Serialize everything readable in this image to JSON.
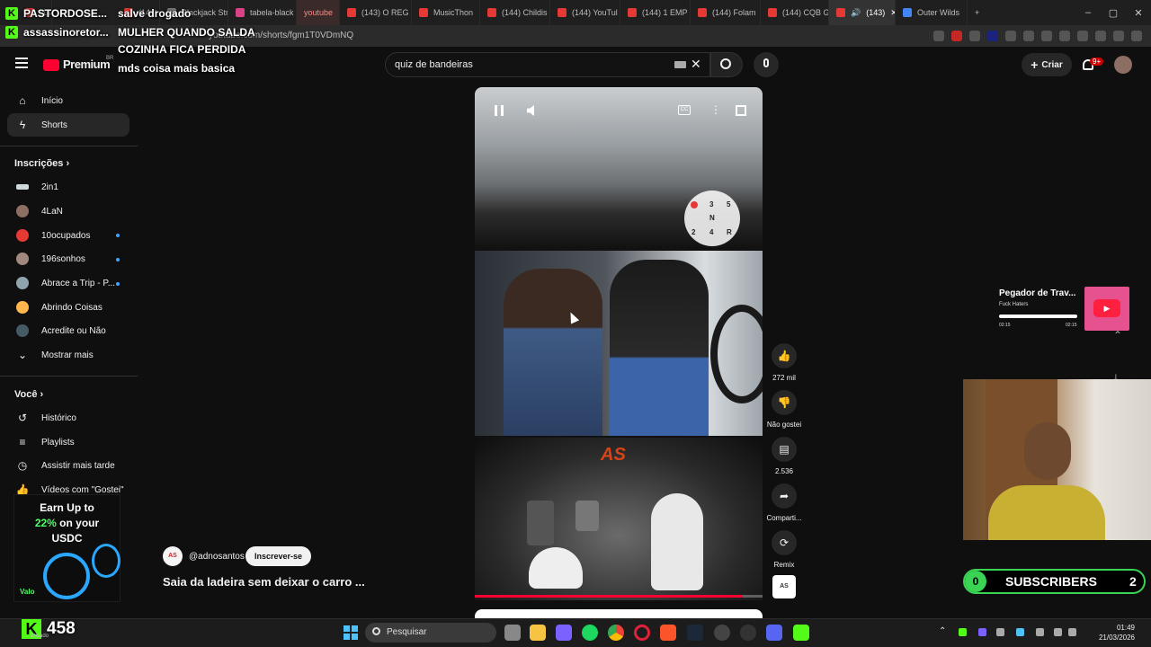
{
  "browser": {
    "tabs": [
      {
        "label": "(144) te...",
        "active": false
      },
      {
        "label": "(144) we",
        "active": false
      },
      {
        "label": "Blackjack Str",
        "active": false
      },
      {
        "label": "tabela-black",
        "active": false
      },
      {
        "label": "youtube",
        "active": false
      },
      {
        "label": "(143) O REG",
        "active": false
      },
      {
        "label": "MusicThon",
        "active": false
      },
      {
        "label": "(144) Childis",
        "active": false
      },
      {
        "label": "(144) YouTul",
        "active": false
      },
      {
        "label": "(144) 1 EMP",
        "active": false
      },
      {
        "label": "(144) Folam",
        "active": false
      },
      {
        "label": "(144) CQB G",
        "active": false
      },
      {
        "label": "(143)",
        "active": true
      },
      {
        "label": "Outer Wilds",
        "active": false
      }
    ],
    "url": "youtube.com/shorts/fgm1T0VDmNQ",
    "new_tab": "+",
    "window_controls": [
      "–",
      "▢",
      "✕"
    ]
  },
  "chat_overlay": {
    "lines": [
      {
        "user": "PASTORDOSE...",
        "message": "salve drogado"
      },
      {
        "user": "assassinoretor...",
        "message": "MULHER QUANDO SALDA"
      },
      {
        "user": "",
        "message": "COZINHA FICA PERDIDA"
      },
      {
        "user": "",
        "message": "mds coisa mais basica"
      }
    ]
  },
  "youtube": {
    "logo_text": "Premium",
    "logo_region": "BR",
    "search_value": "quiz de bandeiras",
    "create_label": "Criar",
    "notifications_badge": "9+",
    "sidebar": {
      "main": [
        {
          "label": "Início",
          "icon": "home-icon",
          "active": false
        },
        {
          "label": "Shorts",
          "icon": "shorts-icon",
          "active": true
        }
      ],
      "subscriptions_title": "Inscrições",
      "subscriptions": [
        {
          "label": "2in1",
          "color": "#cfd8dc",
          "new": false
        },
        {
          "label": "4LaN",
          "color": "#8d6e63",
          "new": false
        },
        {
          "label": "10ocupados",
          "color": "#e53935",
          "new": true
        },
        {
          "label": "196sonhos",
          "color": "#a1887f",
          "new": true
        },
        {
          "label": "Abrace a Trip - P...",
          "color": "#90a4ae",
          "new": true
        },
        {
          "label": "Abrindo Coisas",
          "color": "#ffb74d",
          "new": false
        },
        {
          "label": "Acredite ou Não",
          "color": "#455a64",
          "new": false
        }
      ],
      "show_more": "Mostrar mais",
      "you_title": "Você",
      "you_items": [
        {
          "label": "Histórico",
          "icon": "history-icon"
        },
        {
          "label": "Playlists",
          "icon": "playlists-icon"
        },
        {
          "label": "Assistir mais tarde",
          "icon": "watch-later-icon"
        },
        {
          "label": "Vídeos com \"Gostei\"",
          "icon": "liked-icon"
        }
      ]
    },
    "short": {
      "channel": "@adnosantos",
      "channel_avatar_text": "AS",
      "subscribe_label": "Inscrever-se",
      "title": "Saia da ladeira sem deixar o carro ...",
      "progress": 0.93,
      "gear_labels": [
        "1",
        "3",
        "5",
        "N",
        "2",
        "4",
        "R"
      ],
      "video_watermark": "AS",
      "actions": [
        {
          "icon": "like-icon",
          "label": "272 mil"
        },
        {
          "icon": "dislike-icon",
          "label": "Não gostei"
        },
        {
          "icon": "comment-icon",
          "label": "2.536"
        },
        {
          "icon": "share-icon",
          "label": "Comparti..."
        },
        {
          "icon": "remix-icon",
          "label": "Remix"
        }
      ]
    }
  },
  "stream_overlay": {
    "music": {
      "title": "Pegador de Trav...",
      "artist": "Fuck Haters",
      "time_left": "02:15",
      "time_right": "02:15"
    },
    "subscribers": {
      "left": "0",
      "label": "SUBSCRIBERS",
      "right": "2"
    },
    "ad": {
      "line1": "Earn Up to",
      "line2_highlight": "22%",
      "line2_rest": " on your",
      "line3": "USDC",
      "brand": "Valo"
    },
    "viewer_count": "458",
    "kick_status": "Ativado"
  },
  "taskbar": {
    "search_label": "Pesquisar",
    "time": "01:49",
    "date": "21/03/2026"
  }
}
